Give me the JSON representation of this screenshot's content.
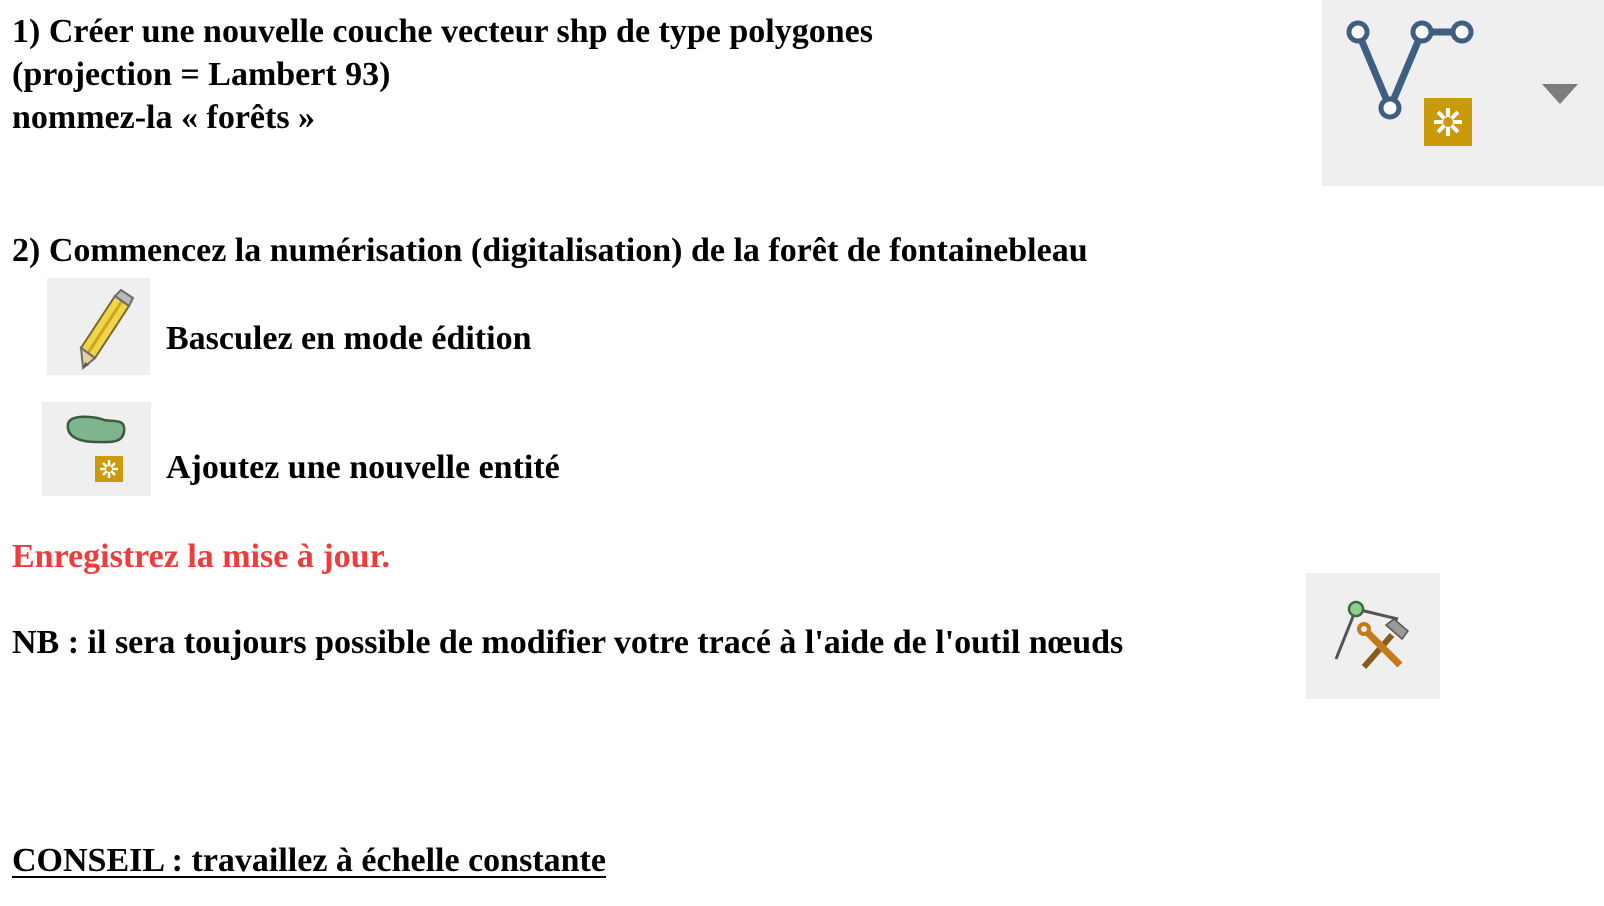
{
  "section1": {
    "line1": "1) Créer une nouvelle couche vecteur shp de type polygones",
    "line2": "(projection = Lambert 93)",
    "line3": "nommez-la « forêts »",
    "icon": "new-shapefile-layer-icon",
    "dropdown_icon": "dropdown-arrow-icon"
  },
  "section2": {
    "heading": "2) Commencez la numérisation (digitalisation) de la forêt de fontainebleau",
    "step_edit": {
      "icon": "pencil-icon",
      "label": "Basculez en mode édition"
    },
    "step_add": {
      "icon": "add-polygon-feature-icon",
      "label": "Ajoutez une nouvelle entité"
    }
  },
  "save_note": "Enregistrez la mise à jour.",
  "nb_note": {
    "text": "NB : il sera toujours possible de modifier votre tracé à l'aide de l'outil nœuds",
    "icon": "node-tool-icon"
  },
  "advice": "CONSEIL : travaillez à échelle constante",
  "colors": {
    "text": "#000000",
    "highlight": "#ee3b3b",
    "icon_background": "#efefef",
    "node_blue": "#3f5f82",
    "new_badge": "#c99a0a",
    "polygon_green": "#7fb58e"
  }
}
